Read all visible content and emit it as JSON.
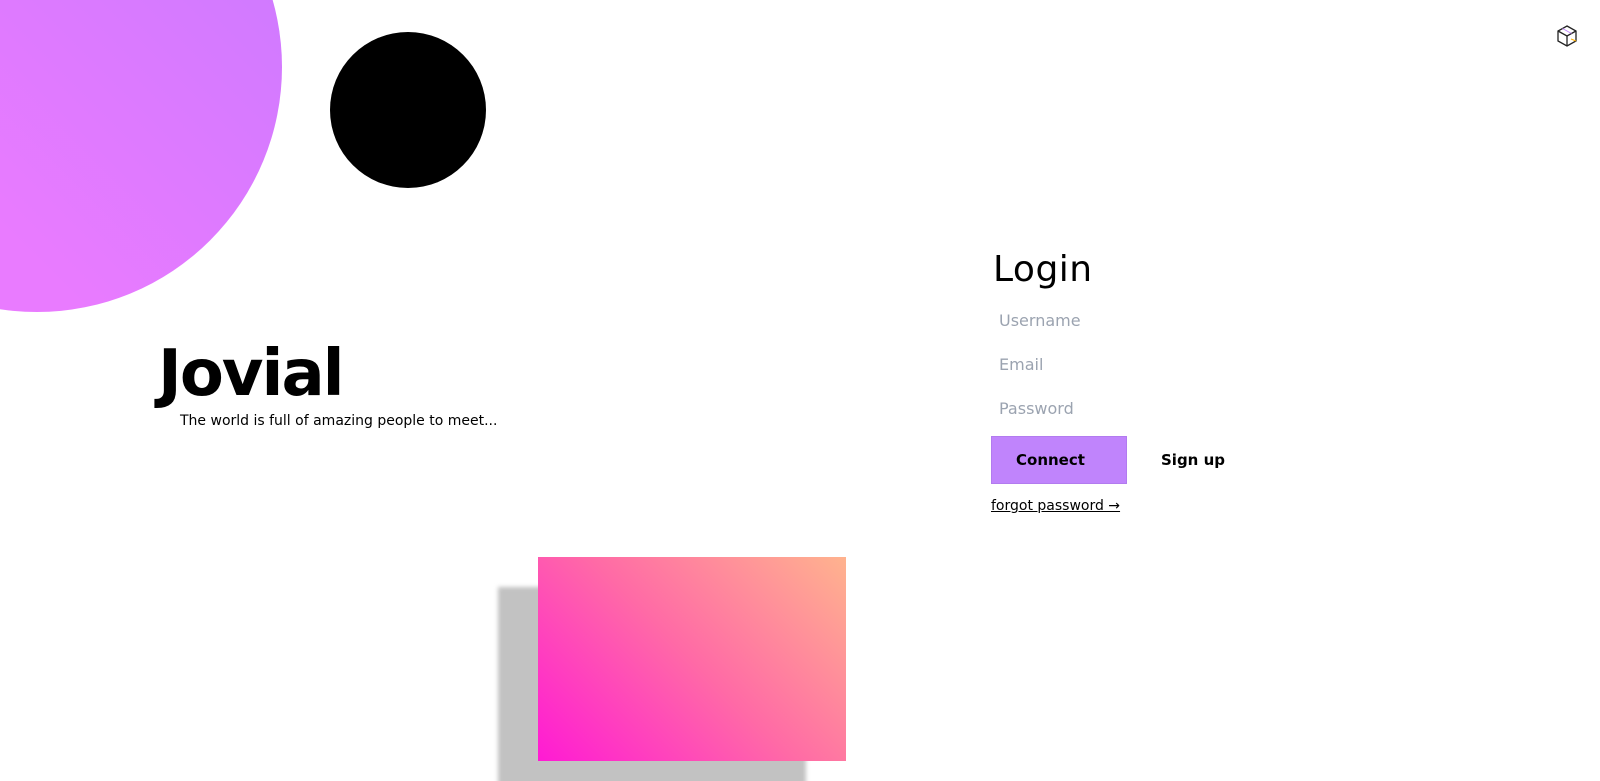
{
  "brand": {
    "title": "Jovial",
    "tagline": "The world is full of amazing people to meet..."
  },
  "login": {
    "title": "Login",
    "username_placeholder": "Username",
    "email_placeholder": "Email",
    "password_placeholder": "Password",
    "connect_label": "Connect",
    "signup_label": "Sign up",
    "forgot_label": "forgot password →"
  },
  "colors": {
    "accent": "#c084fc",
    "blob_start": "#c879ff",
    "blob_end": "#e97bff",
    "rect_gradient_start": "#ff1ad4",
    "rect_gradient_end": "#ffb38e"
  },
  "icons": {
    "top_right": "cube-icon"
  }
}
